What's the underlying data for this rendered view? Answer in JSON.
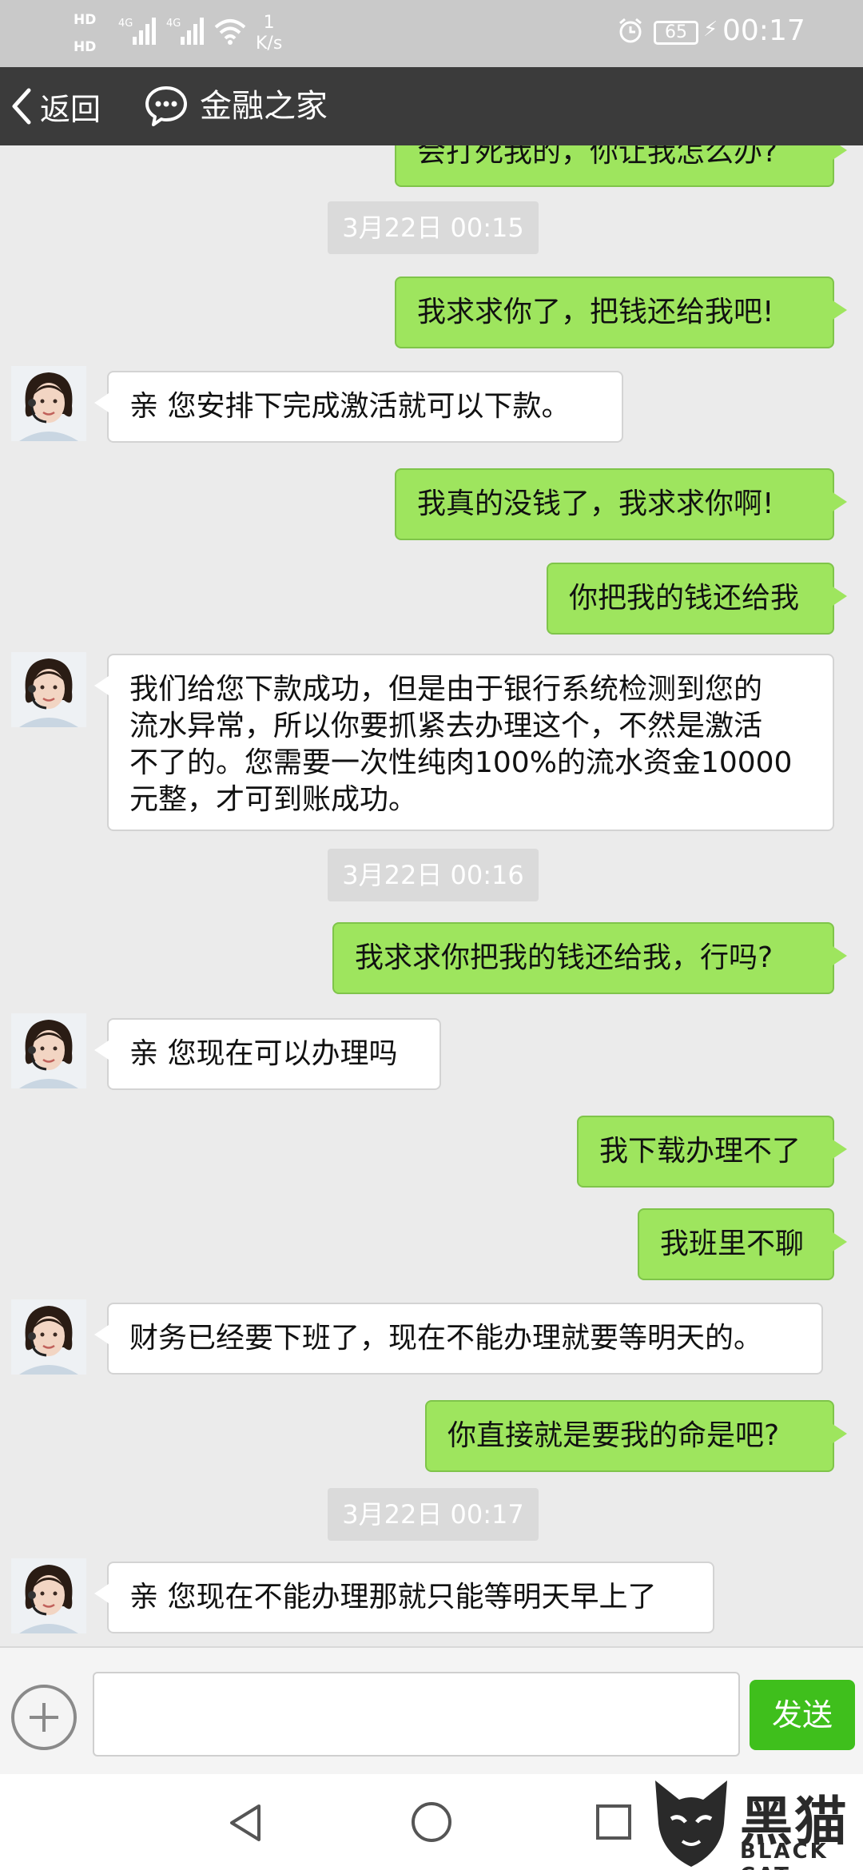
{
  "status_bar": {
    "hd1": "HD",
    "hd2": "HD",
    "net1": "4G",
    "net2": "4G",
    "speed_value": "1",
    "speed_unit": "K/s",
    "battery": "65",
    "time": "00:17"
  },
  "header": {
    "back_label": "返回",
    "title": "金融之家"
  },
  "messages": {
    "m0": "会打死我的，你让我怎么办?",
    "t1": "3月22日 00:15",
    "m1": "我求求你了，把钱还给我吧!",
    "m2": "亲  您安排下完成激活就可以下款。",
    "m3": "我真的没钱了，我求求你啊!",
    "m4": "你把我的钱还给我",
    "m5_l1": "我们给您下款成功，但是由于银行系统检测到您的",
    "m5_l2": "流水异常，所以你要抓紧去办理这个，不然是激活",
    "m5_l3": "不了的。您需要一次性纯肉100%的流水资金10000",
    "m5_l4": "元整，才可到账成功。",
    "t2": "3月22日 00:16",
    "m6": "我求求你把我的钱还给我，行吗?",
    "m7": "亲  您现在可以办理吗",
    "m8": "我下载办理不了",
    "m9": "我班里不聊",
    "m10": "财务已经要下班了，现在不能办理就要等明天的。",
    "m11": "你直接就是要我的命是吧?",
    "t3": "3月22日 00:17",
    "m12": "亲  您现在不能办理那就只能等明天早上了"
  },
  "input": {
    "placeholder": "",
    "send_label": "发送"
  },
  "watermark": {
    "cn": "黑猫",
    "en": "BLACK CAT"
  },
  "colors": {
    "outgoing_bubble": "#9ee55e",
    "incoming_bubble": "#ffffff",
    "nav_bar": "#3b3b3b",
    "send_button": "#3fbf1c"
  }
}
